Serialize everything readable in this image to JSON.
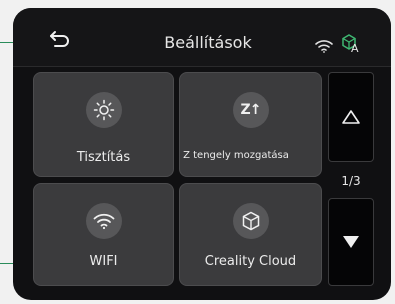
{
  "header": {
    "title": "Beállítások",
    "cloud_status_letter": "A",
    "back_icon": "back-arrow-icon",
    "wifi_icon": "wifi-status-icon",
    "cloud_icon": "cloud-cube-icon"
  },
  "tiles": [
    {
      "label": "Tisztítás",
      "icon": "sun-brightness-icon"
    },
    {
      "label": "Z tengely mozgatása",
      "icon_text": "Z↑",
      "icon": "z-axis-icon"
    },
    {
      "label": "WIFI",
      "icon": "wifi-icon"
    },
    {
      "label": "Creality Cloud",
      "icon": "cloud-cube-icon"
    }
  ],
  "pagination": {
    "current": "1/3",
    "up_icon": "triangle-up-icon",
    "down_icon": "triangle-down-icon"
  },
  "colors": {
    "screen_bg": "#101012",
    "tile_bg": "#3b3b3d",
    "accent_green": "#2a8c5a"
  }
}
